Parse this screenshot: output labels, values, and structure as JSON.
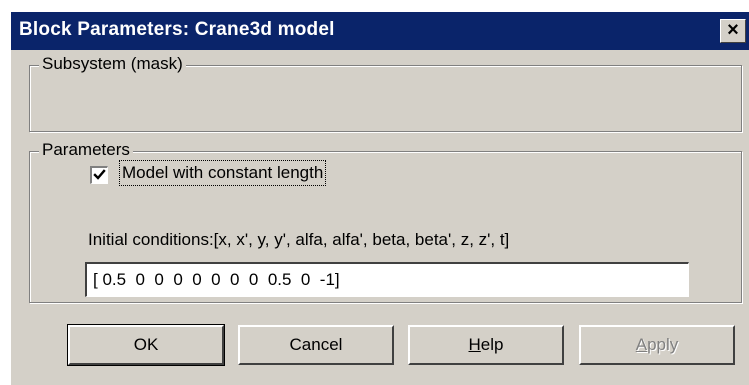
{
  "window": {
    "title": "Block Parameters: Crane3d model",
    "close_label": "✕"
  },
  "subsystem_group": {
    "legend": "Subsystem (mask)"
  },
  "parameters_group": {
    "legend": "Parameters",
    "checkbox": {
      "label": "Model with constant length",
      "checked": true
    },
    "initial_conditions": {
      "label": "Initial conditions:[x, x', y,  y', alfa, alfa', beta, beta', z, z', t]",
      "value": "[ 0.5  0  0  0  0  0  0  0  0.5  0  -1]"
    }
  },
  "buttons": {
    "ok": "OK",
    "cancel": "Cancel",
    "help": "Help",
    "apply": "Apply"
  },
  "colors": {
    "titlebar": "#0a246a",
    "dialog_face": "#d4d0c8",
    "disabled_text": "#808080"
  }
}
